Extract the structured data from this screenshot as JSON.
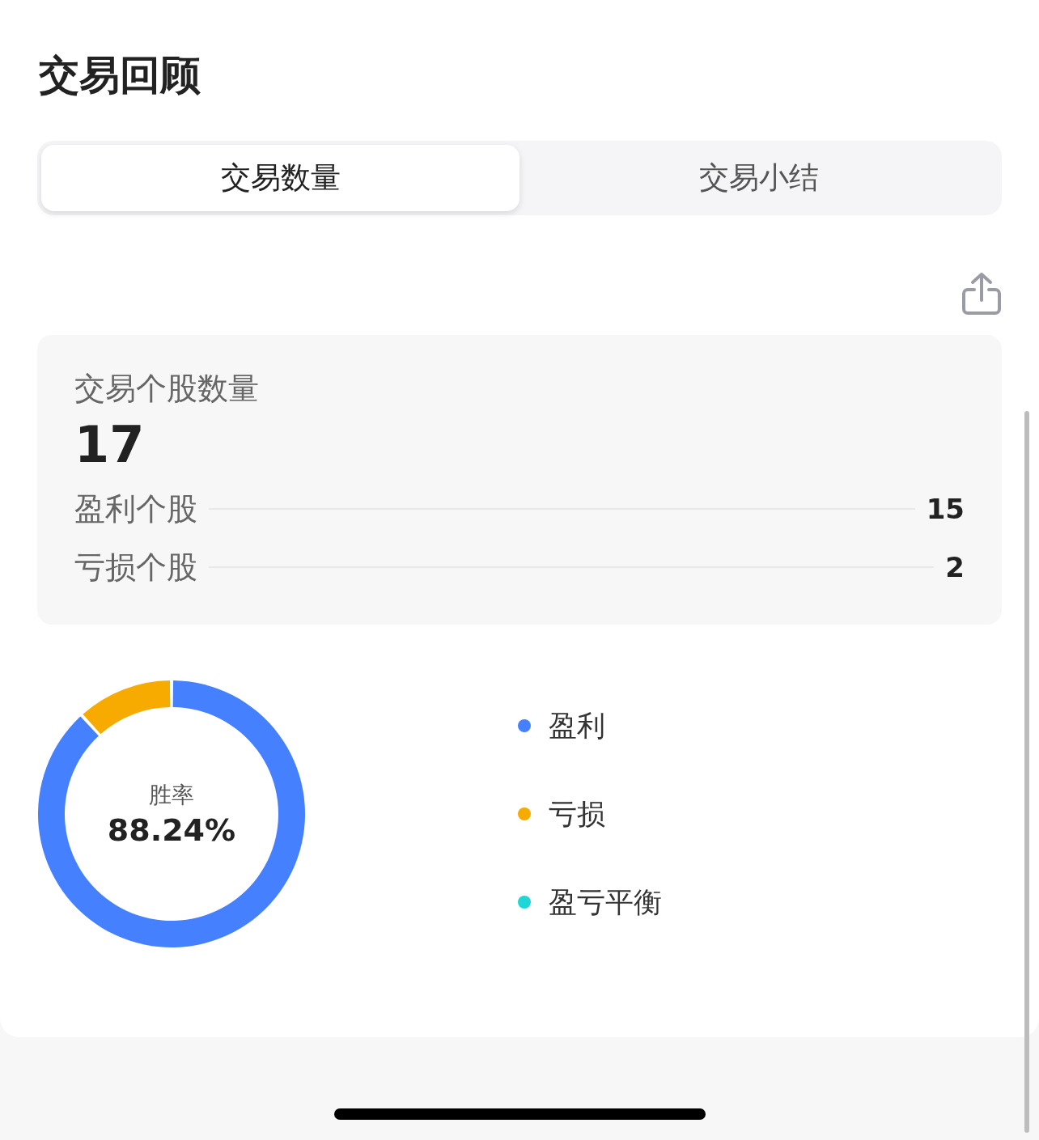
{
  "title": "交易回顾",
  "tabs": [
    {
      "label": "交易数量",
      "selected": true
    },
    {
      "label": "交易小结",
      "selected": false
    }
  ],
  "summary": {
    "label": "交易个股数量",
    "total": "17",
    "rows": [
      {
        "label": "盈利个股",
        "value": "15"
      },
      {
        "label": "亏损个股",
        "value": "2"
      }
    ]
  },
  "win_rate": {
    "label": "胜率",
    "value": "88.24%",
    "chart_data": {
      "type": "donut",
      "categories": [
        "盈利",
        "亏损",
        "盈亏平衡"
      ],
      "values": [
        88.24,
        11.76,
        0
      ],
      "legend": "right",
      "colors": [
        "#4480ff",
        "#f7ab00",
        "#1ed6d6"
      ]
    }
  }
}
